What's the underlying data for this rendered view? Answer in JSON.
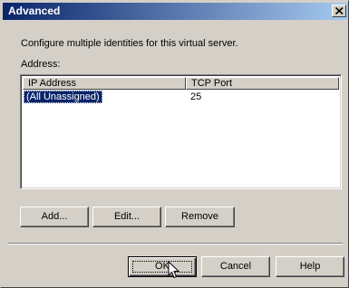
{
  "window": {
    "title": "Advanced"
  },
  "description": "Configure multiple identities for this virtual server.",
  "address": {
    "label": "Address:",
    "columns": [
      "IP Address",
      "TCP Port"
    ],
    "rows": [
      {
        "ip": "(All Unassigned)",
        "port": "25",
        "selected": true
      }
    ]
  },
  "buttons": {
    "add": "Add...",
    "edit": "Edit...",
    "remove": "Remove",
    "ok": "OK",
    "cancel": "Cancel",
    "help": "Help"
  },
  "icons": {
    "close": "close-icon",
    "cursor": "mouse-pointer-icon"
  },
  "colors": {
    "title_start": "#0a246a",
    "title_end": "#a6caf0",
    "face": "#d4d0c8",
    "selection": "#0a246a"
  }
}
